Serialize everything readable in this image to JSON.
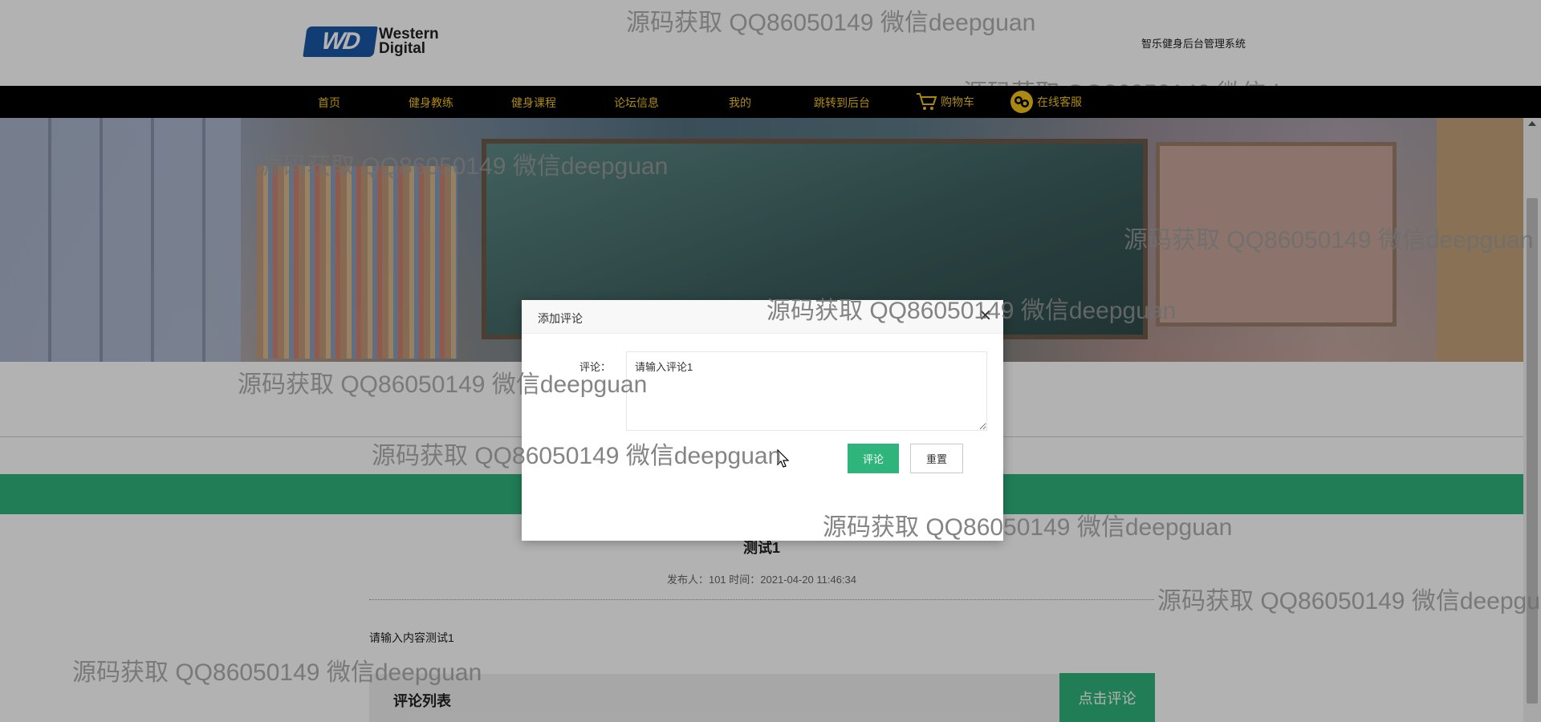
{
  "header": {
    "logo_text_line1": "Western",
    "logo_text_line2": "Digital",
    "logo_badge": "WD",
    "system_title": "智乐健身后台管理系统"
  },
  "nav": {
    "items": [
      {
        "label": "首页"
      },
      {
        "label": "健身教练"
      },
      {
        "label": "健身课程"
      },
      {
        "label": "论坛信息"
      },
      {
        "label": "我的"
      },
      {
        "label": "跳转到后台"
      },
      {
        "label": "购物车",
        "icon": "cart-icon"
      },
      {
        "label": "在线客服",
        "icon": "customer-service-icon"
      }
    ],
    "text_color": "#f5c518"
  },
  "post": {
    "title": "测试1",
    "meta": "发布人：101 时间：2021-04-20 11:46:34",
    "body": "请输入内容测试1"
  },
  "comments": {
    "title": "评论列表",
    "button_label": "点击评论"
  },
  "modal": {
    "title": "添加评论",
    "close_icon": "close-icon",
    "field_label": "评论：",
    "field_value": "请输入评论1",
    "submit_label": "评论",
    "reset_label": "重置"
  },
  "watermark": {
    "text": "源码获取 QQ86050149 微信deepguan"
  },
  "colors": {
    "accent_green": "#2fb47c",
    "nav_bg": "#000000"
  }
}
